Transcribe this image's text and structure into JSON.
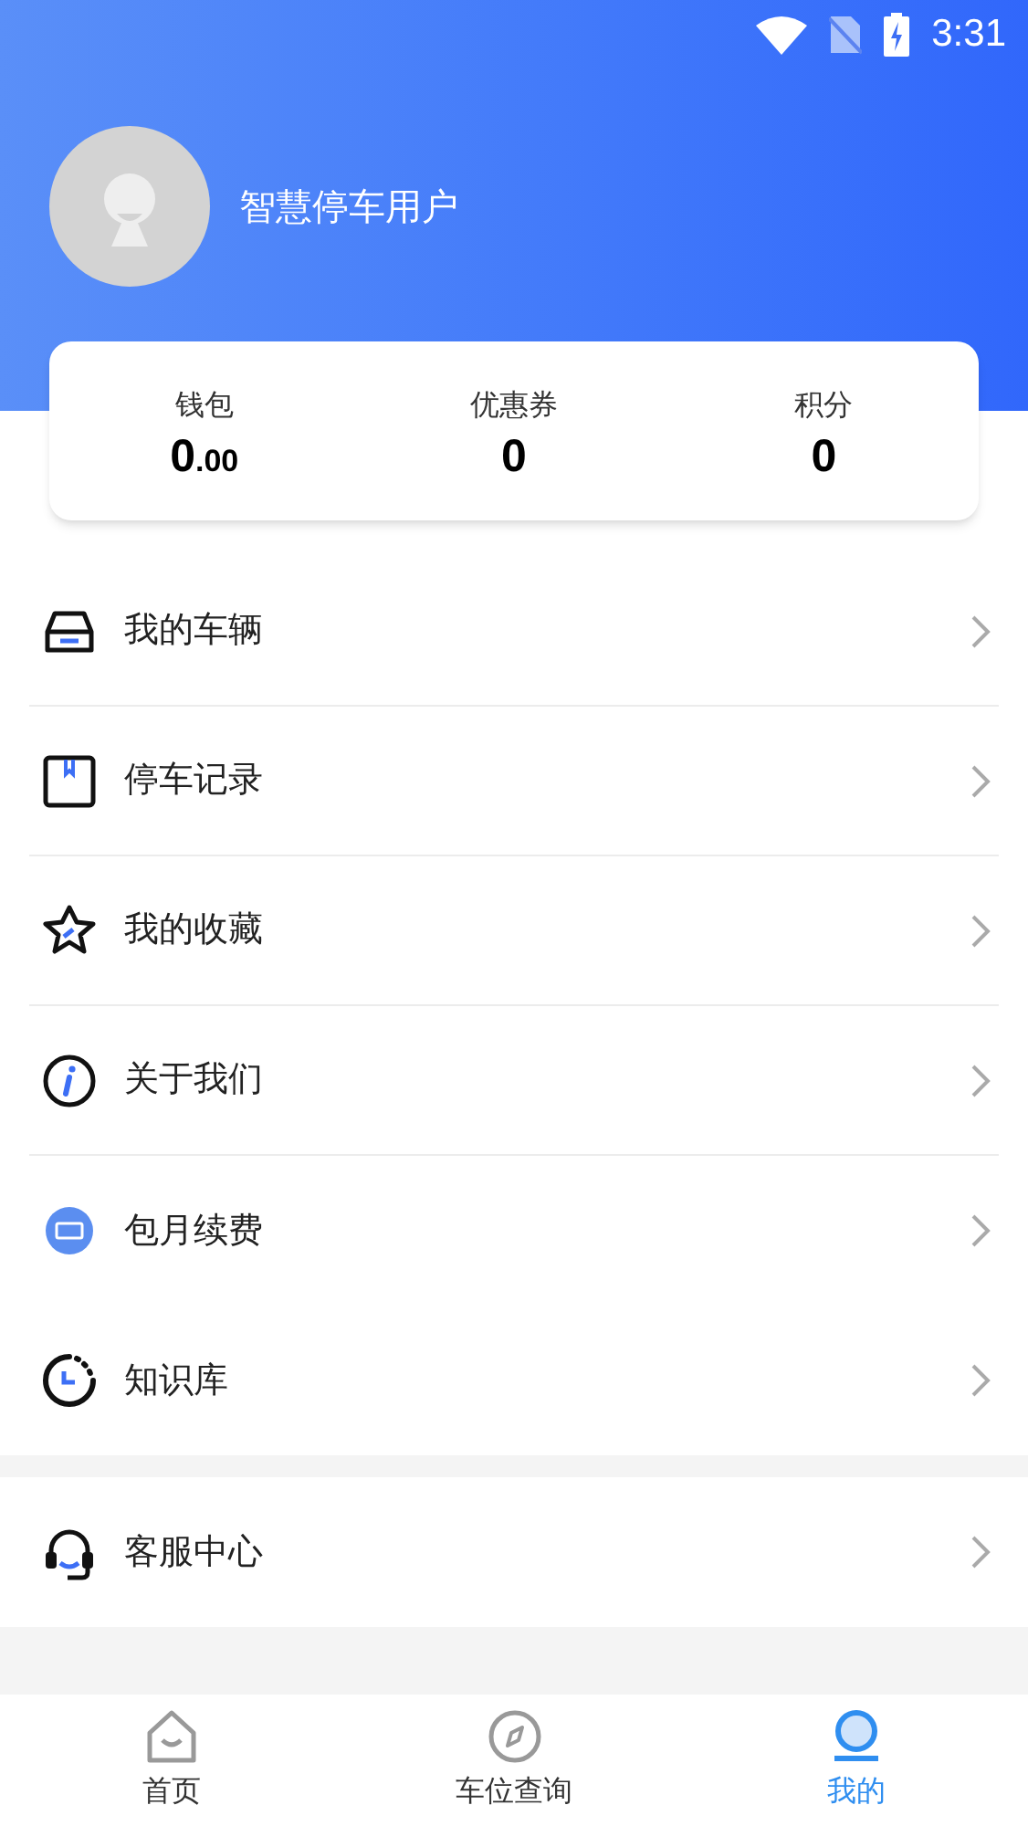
{
  "status_bar": {
    "time": "3:31"
  },
  "profile": {
    "name": "智慧停车用户"
  },
  "stats": [
    {
      "label": "钱包",
      "value": "0",
      "decimals": ".00"
    },
    {
      "label": "优惠券",
      "value": "0"
    },
    {
      "label": "积分",
      "value": "0"
    }
  ],
  "menu_groups": [
    {
      "items": [
        {
          "kind": "car",
          "label": "我的车辆",
          "divider_below": true
        },
        {
          "kind": "record",
          "label": "停车记录",
          "divider_below": true
        },
        {
          "kind": "star",
          "label": "我的收藏",
          "divider_below": true
        },
        {
          "kind": "info",
          "label": "关于我们",
          "divider_below": true
        },
        {
          "kind": "ticket",
          "label": "包月续费",
          "divider_below": false
        },
        {
          "kind": "clock",
          "label": "知识库",
          "divider_below": false
        }
      ]
    },
    {
      "items": [
        {
          "kind": "headset",
          "label": "客服中心",
          "divider_below": false
        }
      ]
    }
  ],
  "tabs": [
    {
      "kind": "home",
      "label": "首页",
      "selected": false
    },
    {
      "kind": "compass",
      "label": "车位查询",
      "selected": false
    },
    {
      "kind": "profile",
      "label": "我的",
      "selected": true
    }
  ]
}
